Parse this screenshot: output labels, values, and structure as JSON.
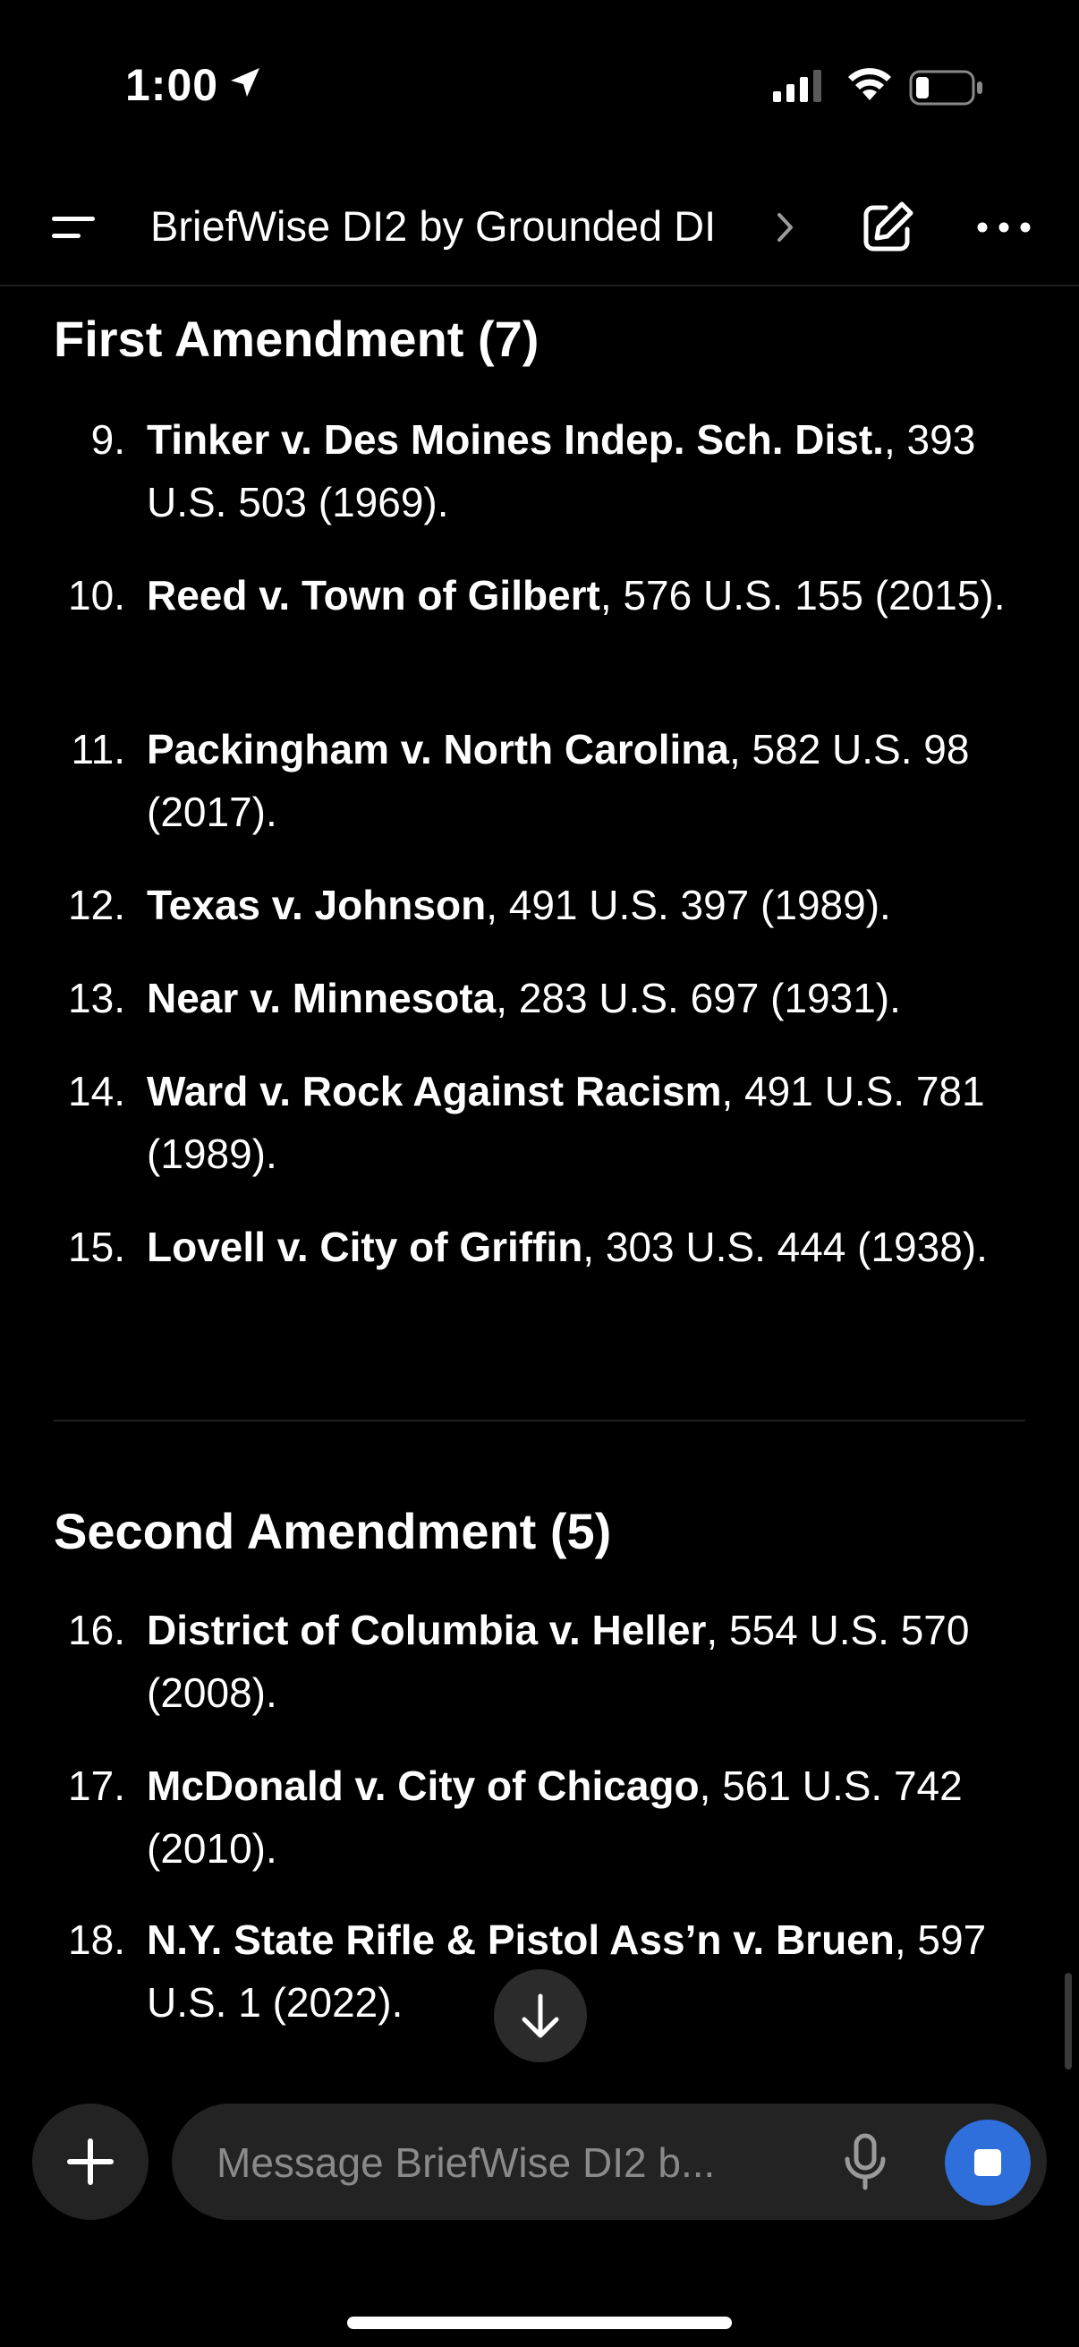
{
  "status_bar": {
    "time": "1:00",
    "icons": [
      "location-arrow-icon",
      "cellular-signal-icon",
      "wifi-icon",
      "battery-icon"
    ]
  },
  "header": {
    "title": "BriefWise DI2 by Grounded DI",
    "icons": [
      "menu-icon",
      "chevron-right-icon",
      "edit-icon",
      "more-icon"
    ]
  },
  "sections": [
    {
      "heading": "First Amendment (7)",
      "items": [
        {
          "num": "9.",
          "case": "Tinker v. Des Moines Indep. Sch. Dist.",
          "cite": ", 393 U.S. 503 (1969)."
        },
        {
          "num": "10.",
          "case": "Reed v. Town of Gilbert",
          "cite": ", 576 U.S. 155 (2015)."
        },
        {
          "num": "11.",
          "case": "Packingham v. North Carolina",
          "cite": ", 582 U.S. 98 (2017)."
        },
        {
          "num": "12.",
          "case": "Texas v. Johnson",
          "cite": ", 491 U.S. 397 (1989)."
        },
        {
          "num": "13.",
          "case": "Near v. Minnesota",
          "cite": ", 283 U.S. 697 (1931)."
        },
        {
          "num": "14.",
          "case": "Ward v. Rock Against Racism",
          "cite": ", 491 U.S. 781 (1989)."
        },
        {
          "num": "15.",
          "case": "Lovell v. City of Griffin",
          "cite": ", 303 U.S. 444 (1938)."
        }
      ]
    },
    {
      "heading": "Second Amendment (5)",
      "items": [
        {
          "num": "16.",
          "case": "District of Columbia v. Heller",
          "cite": ", 554 U.S. 570 (2008)."
        },
        {
          "num": "17.",
          "case": "McDonald v. City of Chicago",
          "cite": ", 561 U.S. 742 (2010)."
        },
        {
          "num": "18.",
          "case": "N.Y. State Rifle & Pistol Ass’n v. Bruen",
          "cite": ", 597 U.S. 1 (2022)."
        }
      ]
    }
  ],
  "composer": {
    "placeholder": "Message BriefWise DI2 b...",
    "icons": [
      "plus-icon",
      "microphone-icon",
      "stop-icon",
      "arrow-down-icon"
    ]
  },
  "colors": {
    "background": "#000000",
    "surface": "#232323",
    "accent": "#2f6fdb",
    "placeholder": "#8a8a8a"
  }
}
